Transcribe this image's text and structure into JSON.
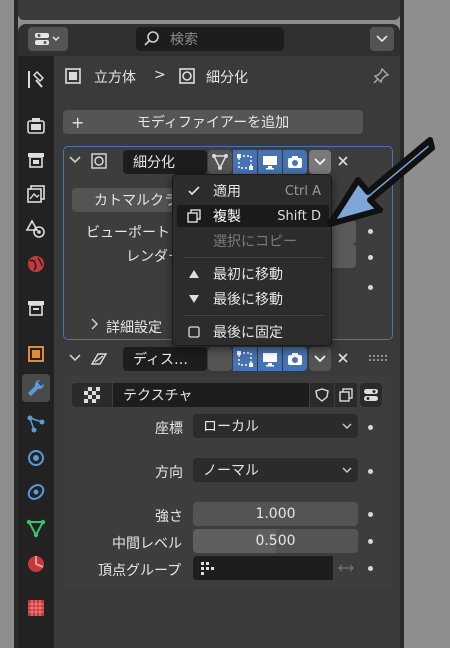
{
  "header": {
    "search_placeholder": "検索"
  },
  "breadcrumb": {
    "object_name": "立方体",
    "separator": ">",
    "modifier_name": "細分化"
  },
  "add_modifier": {
    "plus": "+",
    "label": "モディファイアーを追加"
  },
  "modifier1": {
    "name": "細分化",
    "type_button": "カトマルクラ",
    "viewport_label": "ビューポート",
    "render_label": "レンダー",
    "advanced_label": "詳細設定"
  },
  "context_menu": {
    "items": [
      {
        "label": "適用",
        "shortcut": "Ctrl A",
        "icon": "check-icon"
      },
      {
        "label": "複製",
        "shortcut": "Shift D",
        "icon": "duplicate-icon"
      },
      {
        "label": "選択にコピー",
        "shortcut": "",
        "icon": ""
      },
      {
        "label": "最初に移動",
        "shortcut": "",
        "icon": "triangle-up-icon"
      },
      {
        "label": "最後に移動",
        "shortcut": "",
        "icon": "triangle-down-icon"
      },
      {
        "label": "最後に固定",
        "shortcut": "",
        "icon": "checkbox-icon"
      }
    ],
    "highlighted_index": 1
  },
  "modifier2": {
    "name": "ディス…",
    "texture_label": "テクスチャ",
    "coords_label": "座標",
    "coords_value": "ローカル",
    "direction_label": "方向",
    "direction_value": "ノーマル",
    "strength_label": "強さ",
    "strength_value": "1.000",
    "midlevel_label": "中間レベル",
    "midlevel_value": "0.500",
    "vgroup_label": "頂点グループ"
  },
  "colors": {
    "accent_blue": "#4772b3",
    "panel_bg": "#3a3a3a",
    "arrow_fill": "#7ea6d9"
  }
}
